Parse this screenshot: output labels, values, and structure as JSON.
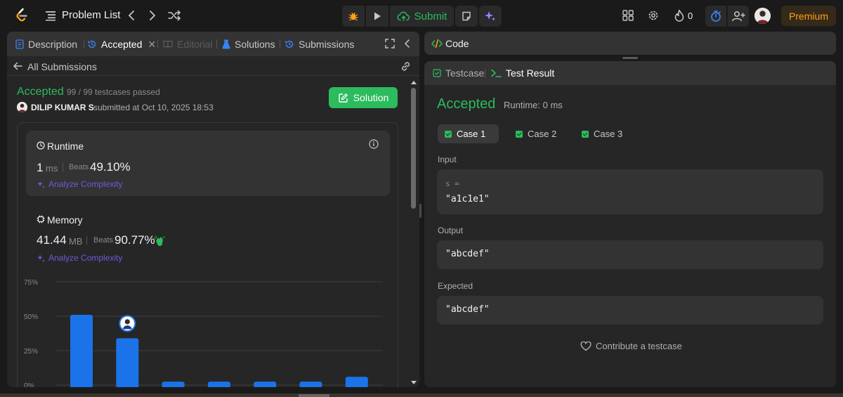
{
  "topbar": {
    "problem_list_label": "Problem List",
    "submit_label": "Submit",
    "fire_count": "0",
    "premium_label": "Premium",
    "icons": [
      "leetcode-logo-icon",
      "list-icon",
      "chevron-left-icon",
      "chevron-right-icon",
      "shuffle-icon",
      "debug-icon",
      "play-icon",
      "cloud-upload-icon",
      "note-icon",
      "sparkle-icon",
      "layout-icon",
      "gear-icon",
      "flame-icon",
      "timer-icon",
      "add-friend-icon"
    ]
  },
  "left": {
    "tabs": {
      "description": "Description",
      "accepted": "Accepted",
      "editorial": "Editorial",
      "solutions": "Solutions",
      "submissions": "Submissions"
    },
    "back_label": "All Submissions",
    "status": "Accepted",
    "testcases": "99 / 99 testcases passed",
    "author": "DILIP KUMAR S",
    "submitted_at": "submitted at Oct 10, 2025 18:53",
    "solution_button": "Solution",
    "runtime": {
      "title": "Runtime",
      "value": "1",
      "unit": "ms",
      "beats_label": "Beats",
      "beats_pct": "49.10%",
      "analyze": "Analyze Complexity"
    },
    "memory": {
      "title": "Memory",
      "value": "41.44",
      "unit": "MB",
      "beats_label": "Beats",
      "beats_pct": "90.77%",
      "analyze": "Analyze Complexity"
    }
  },
  "chart_data": {
    "type": "bar",
    "y_ticks": [
      "75%",
      "50%",
      "25%",
      "0%"
    ],
    "ylim": [
      0,
      75
    ],
    "values": [
      51,
      34,
      2.5,
      2.5,
      2.5,
      2.5,
      6
    ],
    "highlight_index": 1,
    "colors": {
      "bar": "#1a73e8",
      "grid": "#3e3e3e"
    }
  },
  "right": {
    "code_label": "Code",
    "testcase_tab": "Testcase",
    "test_result_tab": "Test Result",
    "result_status": "Accepted",
    "runtime_text": "Runtime: 0 ms",
    "cases": [
      "Case 1",
      "Case 2",
      "Case 3"
    ],
    "input_label": "Input",
    "input_var": "s =",
    "input_value": "\"a1c1e1\"",
    "output_label": "Output",
    "output_value": "\"abcdef\"",
    "expected_label": "Expected",
    "expected_value": "\"abcdef\"",
    "contribute": "Contribute a testcase"
  },
  "colors": {
    "accent_green": "#2cbb5d",
    "premium": "#ffa116",
    "analyze_purple": "#6f5bd9",
    "timer_blue": "#3b82f6"
  }
}
